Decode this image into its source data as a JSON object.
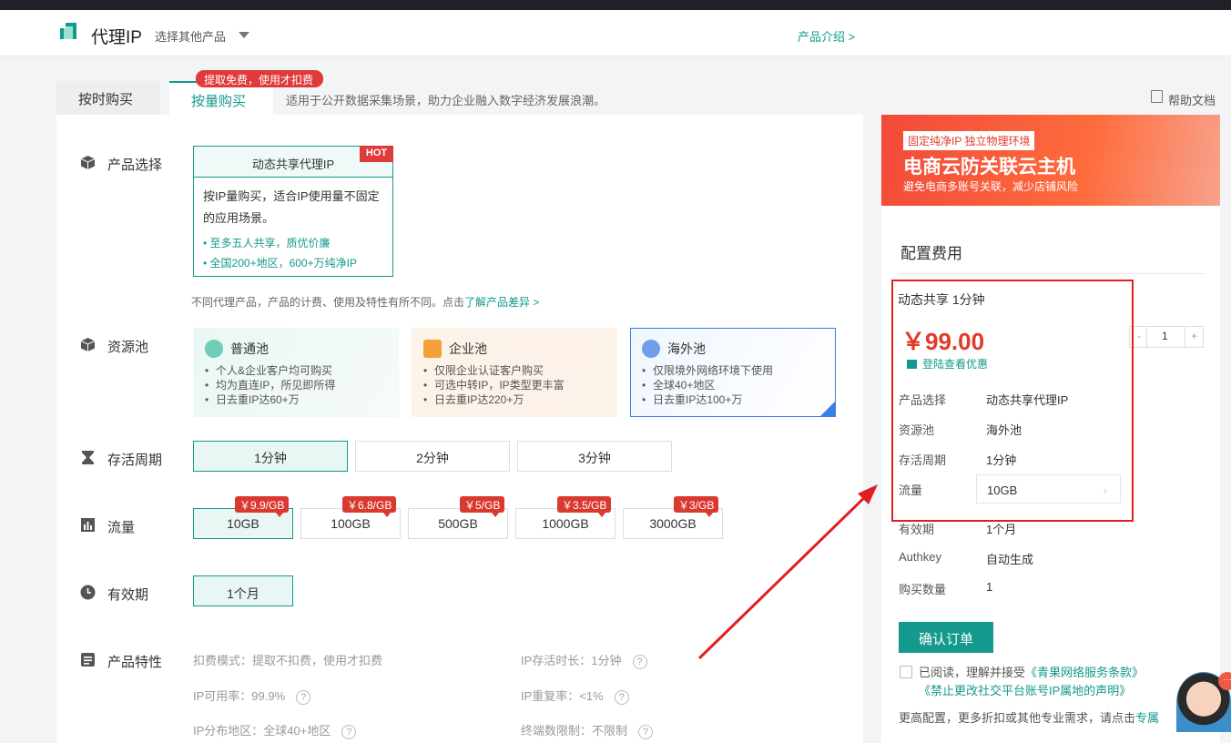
{
  "header": {
    "brand": "代理IP",
    "product_select": "选择其他产品",
    "intro": "产品介绍 >"
  },
  "tabs": {
    "tab1": "按时购买",
    "tab2": "按量购买",
    "badge": "提取免费，使用才扣费",
    "desc": "适用于公开数据采集场景，助力企业融入数字经济发展浪潮。",
    "help": "帮助文档"
  },
  "rows": {
    "product": "产品选择",
    "pool": "资源池",
    "survival": "存活周期",
    "flow": "流量",
    "valid": "有效期",
    "features": "产品特性"
  },
  "product_card": {
    "title": "动态共享代理IP",
    "hot": "HOT",
    "desc": "按IP量购买，适合IP使用量不固定的应用场景。",
    "items": [
      "至多五人共享，质优价廉",
      "全国200+地区，600+万纯净IP"
    ]
  },
  "note": {
    "text": "不同代理产品，产品的计费、使用及特性有所不同。点击",
    "link": "了解产品差异 >"
  },
  "pools": [
    {
      "title": "普通池",
      "items": [
        "个人&企业客户均可购买",
        "均为直连IP，所见即所得",
        "日去重IP达60+万"
      ]
    },
    {
      "title": "企业池",
      "items": [
        "仅限企业认证客户购买",
        "可选中转IP，IP类型更丰富",
        "日去重IP达220+万"
      ]
    },
    {
      "title": "海外池",
      "items": [
        "仅限境外网络环境下使用",
        "全球40+地区",
        "日去重IP达100+万"
      ]
    }
  ],
  "survival_options": [
    "1分钟",
    "2分钟",
    "3分钟"
  ],
  "flow_options": [
    {
      "label": "10GB",
      "price": "￥9.9/GB"
    },
    {
      "label": "100GB",
      "price": "￥6.8/GB"
    },
    {
      "label": "500GB",
      "price": "￥5/GB"
    },
    {
      "label": "1000GB",
      "price": "￥3.5/GB"
    },
    {
      "label": "3000GB",
      "price": "￥3/GB"
    }
  ],
  "valid_option": "1个月",
  "features": [
    "扣费模式：提取不扣费，使用才扣费",
    "IP存活时长：1分钟",
    "IP可用率：99.9%",
    "IP重复率：<1%",
    "IP分布地区：全球40+地区",
    "终端数限制：不限制"
  ],
  "banner": {
    "tag": "固定纯净IP 独立物理环境",
    "title": "电商云防关联云主机",
    "sub": "避免电商多账号关联，减少店铺风险"
  },
  "config": {
    "title": "配置费用",
    "summary": "动态共享  1分钟",
    "price": "￥99.00",
    "coupon": "登陆查看优惠",
    "qty_minus": "-",
    "qty": "1",
    "qty_plus": "+",
    "rows": [
      {
        "k": "产品选择",
        "v": "动态共享代理IP"
      },
      {
        "k": "资源池",
        "v": "海外池"
      },
      {
        "k": "存活周期",
        "v": "1分钟"
      },
      {
        "k": "流量",
        "v": "10GB"
      },
      {
        "k": "有效期",
        "v": "1个月"
      },
      {
        "k": "Authkey",
        "v": "自动生成"
      },
      {
        "k": "购买数量",
        "v": "1"
      }
    ],
    "confirm": "确认订单",
    "agree_prefix": "已阅读，理解并接受",
    "agree_link1": "《青果网络服务条款》",
    "agree_link2": "《禁止更改社交平台账号IP属地的声明》",
    "more_text": "更高配置，更多折扣或其他专业需求，请点击",
    "more_link": "专属"
  },
  "chat": {
    "dots": "···"
  }
}
